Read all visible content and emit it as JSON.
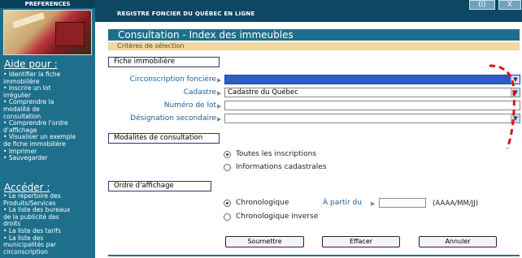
{
  "sidebar": {
    "preferences": "PREFERENCES",
    "help_heading": "Aide pour :",
    "help_links": [
      "Identifier la fiche",
      "immobilière",
      "Inscrire un lot",
      "irrégulier",
      "Comprendre la",
      "modalité de",
      "consultation",
      "Comprendre l'ordre",
      "d'affichage",
      "Visualiser un exemple",
      "de fiche immobilière",
      "Imprimer",
      "Sauvegarder"
    ],
    "access_heading": "Accéder :",
    "access_links": [
      "Le répertoire des",
      "Produits/Services",
      "La liste des bureaux",
      "de la publicité des",
      "droits",
      "La liste des tarifs",
      "La liste des",
      "municipalités par",
      "circonscription"
    ]
  },
  "header": {
    "title": "REGISTRE FONCIER DU QUÉBEC EN LIGNE",
    "help_btn": "(i)",
    "close_btn": "X"
  },
  "page": {
    "title": "Consultation - Index des immeubles",
    "criteria": "Critères de sélection",
    "section_fiche": "Fiche immobilière",
    "fields": {
      "circonscription": {
        "label": "Circonscription foncière",
        "value": ""
      },
      "cadastre": {
        "label": "Cadastre",
        "value": "Cadastre du Québec"
      },
      "lot": {
        "label": "Numéro de lot",
        "value": ""
      },
      "designation": {
        "label": "Désignation secondaire",
        "value": ""
      }
    },
    "section_modalites": "Modalités de consultation",
    "modalites": {
      "opt1": "Toutes les inscriptions",
      "opt2": "Informations cadastrales",
      "selected": "opt1"
    },
    "section_ordre": "Ordre d'affichage",
    "ordre": {
      "opt1": "Chronologique",
      "opt2": "Chronologique inverse",
      "selected": "opt1"
    },
    "date": {
      "label": "À partir du",
      "value": "",
      "format": "(AAAA/MM/JJ)"
    },
    "buttons": {
      "submit": "Soumettre",
      "clear": "Effacer",
      "cancel": "Annuler"
    }
  },
  "colors": {
    "sidebar": "#1d6f8c",
    "header": "#0e4763",
    "criteria_bar": "#f2d8a0",
    "selected_field": "#2c5cc4",
    "annotation": "#e01010"
  }
}
